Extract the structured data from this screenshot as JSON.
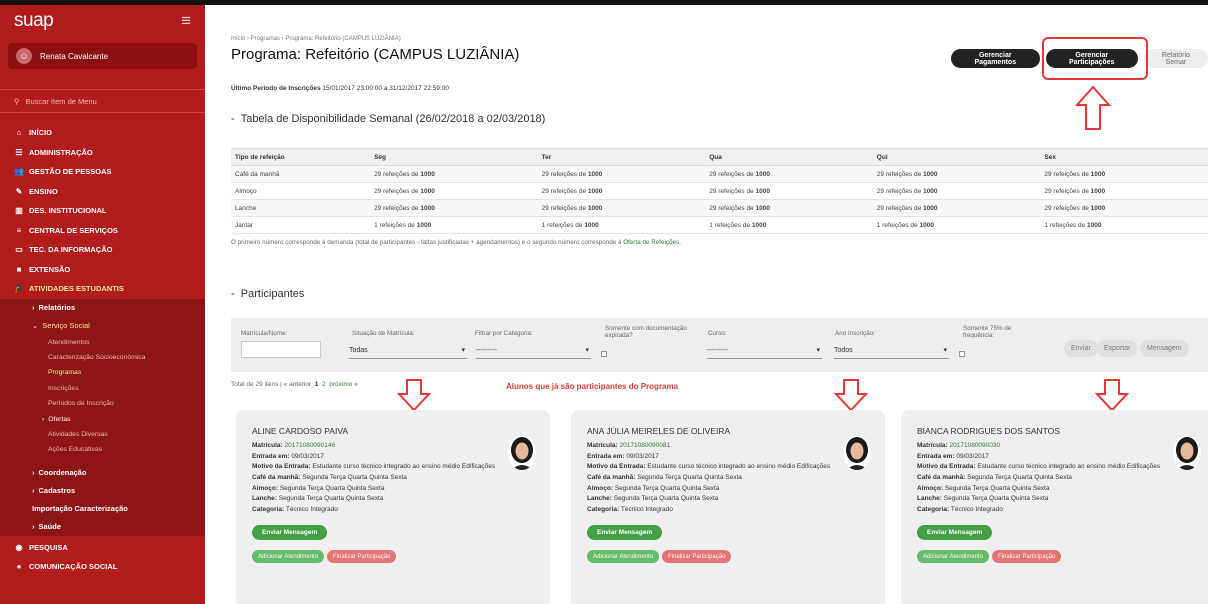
{
  "sidebar": {
    "brand": "suap",
    "user_name": "Renata Cavalcante",
    "search_placeholder": "Buscar Item de Menu",
    "menu": [
      {
        "label": "INÍCIO",
        "icon": "home-icon",
        "glyph": "⌂"
      },
      {
        "label": "ADMINISTRAÇÃO",
        "icon": "list-icon",
        "glyph": "☰"
      },
      {
        "label": "GESTÃO DE PESSOAS",
        "icon": "users-icon",
        "glyph": "👥"
      },
      {
        "label": "ENSINO",
        "icon": "pencil-icon",
        "glyph": "✎"
      },
      {
        "label": "DES. INSTITUCIONAL",
        "icon": "chart-icon",
        "glyph": "▥"
      },
      {
        "label": "CENTRAL DE SERVIÇOS",
        "icon": "lines-icon",
        "glyph": "≡"
      },
      {
        "label": "TEC. DA INFORMAÇÃO",
        "icon": "monitor-icon",
        "glyph": "▭"
      },
      {
        "label": "EXTENSÃO",
        "icon": "briefcase-icon",
        "glyph": "■"
      },
      {
        "label": "ATIVIDADES ESTUDANTIS",
        "icon": "graduation-icon",
        "glyph": "🎓"
      }
    ],
    "sub_relatorios": "Relatórios",
    "sub_servico_social": "Serviço Social",
    "sub2": [
      "Atendimentos",
      "Caracterização Socioeconômica",
      "Programas",
      "Inscrições",
      "Períodos de Inscrição"
    ],
    "ofertas": "Ofertas",
    "sub2b": [
      "Atividades Diversas",
      "Ações Educativas"
    ],
    "sub_after": [
      "Coordenação",
      "Cadastros",
      "Importação Caracterização",
      "Saúde"
    ],
    "menu_bottom": [
      {
        "label": "PESQUISA",
        "icon": "globe-icon",
        "glyph": "◉"
      },
      {
        "label": "COMUNICAÇÃO SOCIAL",
        "icon": "chat-icon",
        "glyph": "●"
      }
    ]
  },
  "header": {
    "breadcrumb": "Início › Programas › Programa: Refeitório (CAMPUS LUZIÂNIA)",
    "title": "Programa: Refeitório (CAMPUS LUZIÂNIA)",
    "btn_pagamentos": "Gerenciar Pagamentos",
    "btn_participacoes": "Gerenciar Participações",
    "btn_relatorio": "Relatório Semar",
    "period_label": "Último Período de Inscrições",
    "period_value": "15/01/2017 23:00:00 a 31/12/2017 22:59:00"
  },
  "availability": {
    "title": "Tabela de Disponibilidade Semanal (26/02/2018 a 02/03/2018)",
    "headers": [
      "Tipo de refeição",
      "Seg",
      "Ter",
      "Qua",
      "Qui",
      "Sex"
    ],
    "rows": [
      {
        "type": "Café da manhã",
        "count": "29",
        "total": "1000"
      },
      {
        "type": "Almoço",
        "count": "29",
        "total": "1000"
      },
      {
        "type": "Lanche",
        "count": "29",
        "total": "1000"
      },
      {
        "type": "Jantar",
        "count": "1",
        "total": "1000"
      }
    ],
    "cell_mid": "refeições de",
    "note": "O primeiro número corresponde à demanda (total de participantes - faltas justificadas + agendamentos) e o segundo número corresponde à",
    "note_link": "Oferta de Refeições."
  },
  "participants": {
    "title": "Participantes",
    "filters": {
      "matricula": "Matrícula/Nome:",
      "situacao": "Situação de Matrícula:",
      "situacao_val": "Todas",
      "categoria": "Filtrar por Categoria:",
      "categoria_val": "---------",
      "doc": "Somente com documentação expirada?",
      "curso": "Curso:",
      "curso_val": "---------",
      "ano": "Ano Inscrição:",
      "ano_val": "Todos",
      "freq": "Somente 75% de frequência:",
      "enviar": "Enviar",
      "exportar": "Exportar",
      "mensagem": "Mensagem"
    },
    "pager": {
      "total": "Total de 29 itens",
      "prev": "« anterior",
      "p1": "1",
      "p2": "2",
      "next": "próximo »"
    },
    "annotation": "Alunos que já são participantes do Programa",
    "labels": {
      "matricula": "Matrícula:",
      "entrada": "Entrada em:",
      "motivo": "Motivo da Entrada:",
      "cafe": "Café da manhã:",
      "almoco": "Almoço:",
      "lanche": "Lanche:",
      "categoria": "Categoria:"
    },
    "cards": [
      {
        "name": "ALINE CARDOSO PAIVA",
        "matricula": "20171080090146",
        "entrada": "09/03/2017",
        "motivo": "Estudante curso técnico integrado ao ensino médio Edificações",
        "cafe": "Segunda Terça Quarta Quinta Sexta",
        "almoco": "Segunda Terça Quarta Quinta Sexta",
        "lanche": "Segunda Terça Quarta Quinta Sexta",
        "categoria": "Técnico Integrado"
      },
      {
        "name": "ANA JÚLIA MEIRELES DE OLIVEIRA",
        "matricula": "20171080090081",
        "entrada": "09/03/2017",
        "motivo": "Estudante curso técnico integrado ao ensino médio Edificações",
        "cafe": "Segunda Terça Quarta Quinta Sexta",
        "almoco": "Segunda Terça Quarta Quinta Sexta",
        "lanche": "Segunda Terça Quarta Quinta Sexta",
        "categoria": "Técnico Integrado"
      },
      {
        "name": "BIANCA RODRIGUES DOS SANTOS",
        "matricula": "20171080090030",
        "entrada": "09/03/2017",
        "motivo": "Estudante curso técnico integrado ao ensino médio Edificações",
        "cafe": "Segunda Terça Quarta Quinta Sexta",
        "almoco": "Segunda Terça Quarta Quinta Sexta",
        "lanche": "Segunda Terça Quarta Quinta Sexta",
        "categoria": "Técnico Integrado"
      }
    ],
    "btn_msg": "Enviar Mensagem",
    "btn_atend": "Adicionar Atendimento",
    "btn_final": "Finalizar Participação"
  }
}
